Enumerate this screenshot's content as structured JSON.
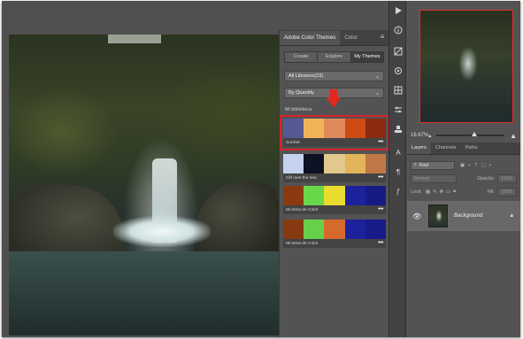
{
  "color_panel": {
    "tabs": [
      "Adobe Color Themes",
      "Color"
    ],
    "menu_icon": "hamburger-menu-icon",
    "segments": [
      "Create",
      "Explore",
      "My Themes"
    ],
    "active_segment": 2,
    "library_dropdown": "All Libraries(23)",
    "sort_dropdown": "By Quantity",
    "library_label": "Mi biblioteca",
    "themes": [
      {
        "name": "SunSet",
        "colors": [
          "#565a92",
          "#f0b458",
          "#e0895a",
          "#cf4a14",
          "#8a2b12"
        ],
        "selected": true
      },
      {
        "name": "Clif over the sea",
        "colors": [
          "#c4d2ee",
          "#0d1224",
          "#e2c88c",
          "#e4b45a",
          "#c17846"
        ],
        "selected": false
      },
      {
        "name": "Mi tema de Color",
        "colors": [
          "#8a3a10",
          "#68d84a",
          "#eadc2e",
          "#1d219c",
          "#171a85"
        ],
        "selected": false
      },
      {
        "name": "Mi tema de Color",
        "colors": [
          "#863a12",
          "#66d04a",
          "#d66a2e",
          "#1e219e",
          "#181a88"
        ],
        "selected": false
      }
    ],
    "more_label": "•••"
  },
  "tool_icons": [
    "play-icon",
    "info-icon",
    "swatch-adjust-icon",
    "brush-settings-icon",
    "grid-icon",
    "sliders-icon",
    "stamp-icon",
    "character-icon",
    "paragraph-icon",
    "glyph-icon"
  ],
  "navigator": {
    "zoom_label": "16.67%",
    "zoom_level": 0.52
  },
  "layers": {
    "tabs": [
      "Layers",
      "Channels",
      "Paths"
    ],
    "filter_placeholder": "Kind",
    "blend_mode": "Normal",
    "opacity_label": "Opacity:",
    "opacity_value": "100%",
    "lock_label": "Lock:",
    "fill_label": "Fill:",
    "fill_value": "100%",
    "layer_name": "Background"
  },
  "accent_colors": {
    "highlight": "#d8222c",
    "panel": "#535353",
    "dark": "#424242"
  }
}
